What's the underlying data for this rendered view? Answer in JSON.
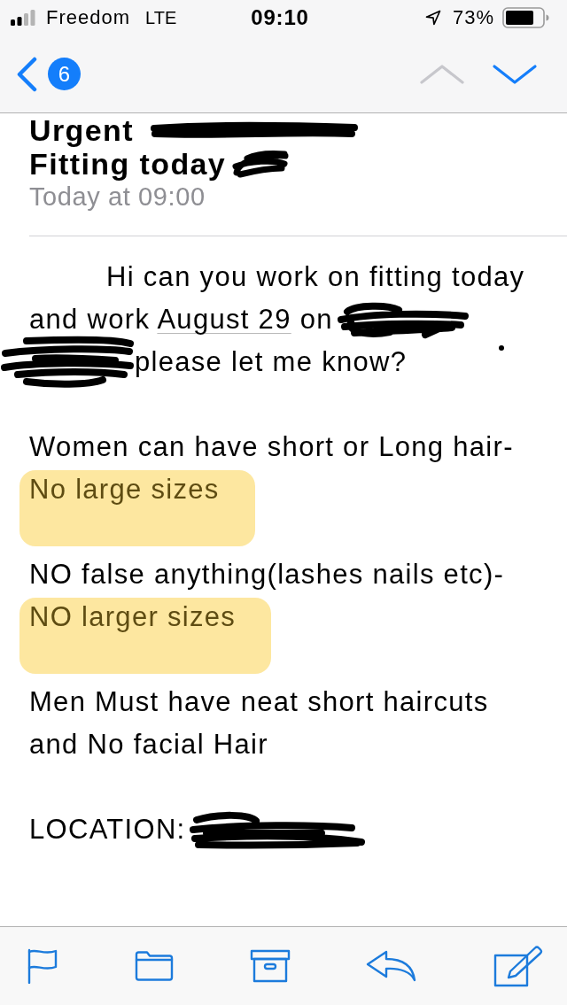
{
  "status_bar": {
    "carrier": "Freedom",
    "network": "LTE",
    "time": "09:10",
    "battery_percent": "73%"
  },
  "nav_bar": {
    "unread_badge": "6",
    "previous_button": {
      "disabled": true
    },
    "next_button": {
      "disabled": false
    }
  },
  "message": {
    "subject_lines": [
      {
        "segments": [
          {
            "kind": "text",
            "text": "Urgent"
          },
          {
            "kind": "redaction"
          }
        ]
      },
      {
        "segments": [
          {
            "kind": "text",
            "text": "Fitting today"
          },
          {
            "kind": "redaction"
          }
        ]
      }
    ],
    "date": "Today at 09:00",
    "body": [
      {
        "lines": [
          {
            "indented": true,
            "highlighted": false,
            "segments": [
              {
                "kind": "text",
                "text": "Hi can you work on fitting today"
              }
            ]
          },
          {
            "indented": false,
            "highlighted": false,
            "segments": [
              {
                "kind": "text",
                "text": "and work"
              },
              {
                "kind": "link",
                "text": "August 29"
              },
              {
                "kind": "text",
                "text": "on"
              },
              {
                "kind": "redaction"
              }
            ]
          },
          {
            "indented": false,
            "highlighted": false,
            "segments": [
              {
                "kind": "redaction"
              },
              {
                "kind": "text",
                "text": "please let me know?"
              }
            ]
          }
        ]
      },
      {
        "lines": [
          {
            "indented": false,
            "highlighted": false,
            "segments": [
              {
                "kind": "text",
                "text": "Women can have short or Long hair-"
              }
            ]
          },
          {
            "indented": false,
            "highlighted": true,
            "segments": [
              {
                "kind": "text",
                "text": "No large sizes"
              }
            ]
          }
        ]
      },
      {
        "lines": [
          {
            "indented": false,
            "highlighted": false,
            "segments": [
              {
                "kind": "text",
                "text": "NO false anything(lashes nails etc)-"
              }
            ]
          },
          {
            "indented": false,
            "highlighted": true,
            "segments": [
              {
                "kind": "text",
                "text": "NO larger sizes"
              }
            ]
          }
        ]
      },
      {
        "lines": [
          {
            "indented": false,
            "highlighted": false,
            "segments": [
              {
                "kind": "text",
                "text": "Men Must have neat short haircuts"
              }
            ]
          },
          {
            "indented": false,
            "highlighted": false,
            "segments": [
              {
                "kind": "text",
                "text": "and No facial Hair"
              }
            ]
          }
        ]
      },
      {
        "lines": [
          {
            "indented": false,
            "highlighted": false,
            "segments": [
              {
                "kind": "text",
                "text": "LOCATION:"
              },
              {
                "kind": "redaction"
              }
            ]
          }
        ]
      }
    ]
  }
}
